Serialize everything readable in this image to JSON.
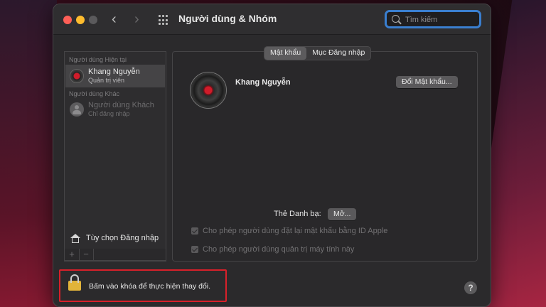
{
  "window": {
    "title": "Người dùng & Nhóm"
  },
  "search": {
    "placeholder": "Tìm kiếm"
  },
  "sidebar": {
    "current_users_header": "Người dùng Hiện tại",
    "current_user": {
      "name": "Khang Nguyễn",
      "role": "Quản trị viên"
    },
    "other_users_header": "Người dùng Khác",
    "guest_user": {
      "name": "Người dùng Khách",
      "role": "Chỉ đăng nhập"
    },
    "login_options_label": "Tùy chọn Đăng nhập",
    "add_label": "+",
    "remove_label": "−"
  },
  "main": {
    "tabs": [
      {
        "label": "Mật khẩu",
        "active": true
      },
      {
        "label": "Mục Đăng nhập",
        "active": false
      }
    ],
    "user_name": "Khang Nguyễn",
    "change_password_label": "Đổi Mật khẩu...",
    "contacts_card_label": "Thẻ Danh bạ:",
    "open_label": "Mở...",
    "checkbox_reset_label": "Cho phép người dùng đặt lại mật khẩu bằng ID Apple",
    "checkbox_admin_label": "Cho phép người dùng quản trị máy tính này"
  },
  "footer": {
    "lock_text": "Bấm vào khóa để thực hiện thay đổi.",
    "help_label": "?"
  },
  "colors": {
    "highlight_box": "#d8202a",
    "search_focus": "#3a7fd0",
    "lock": "#e2b43a"
  },
  "icons": [
    "back-icon",
    "forward-icon",
    "grid-icon",
    "search-icon",
    "home-icon",
    "lock-icon",
    "help-icon"
  ]
}
